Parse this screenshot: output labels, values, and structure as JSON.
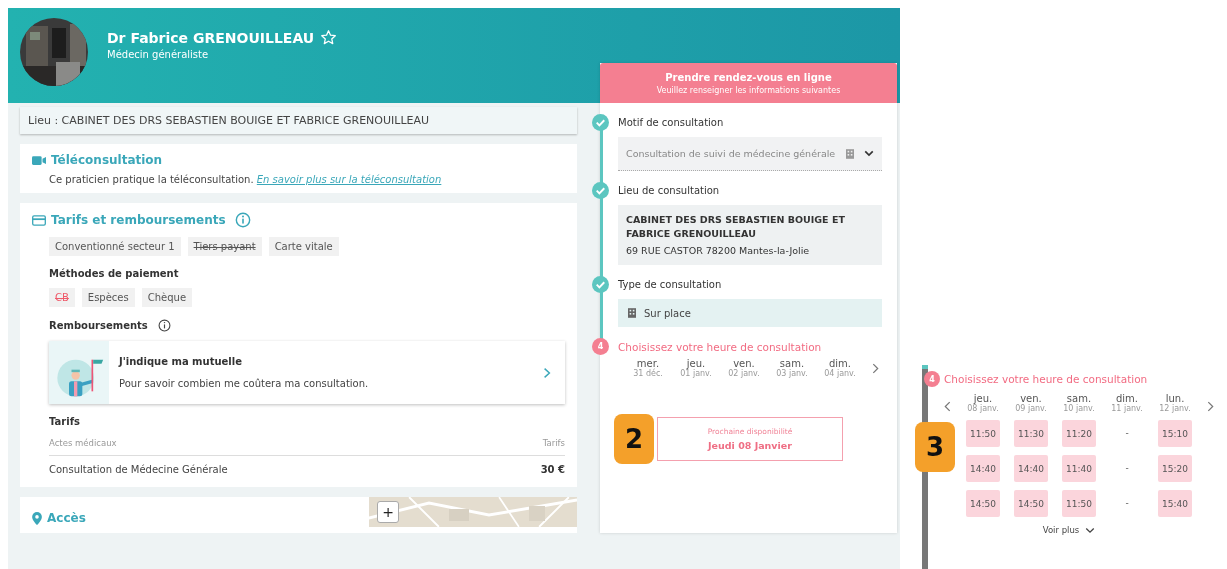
{
  "doctor": {
    "name": "Dr Fabrice GRENOUILLEAU",
    "specialty": "Médecin généraliste",
    "favorite": false
  },
  "location_bar": "Lieu : CABINET DES DRS SEBASTIEN BOUIGE ET FABRICE GRENOUILLEAU",
  "teleconsultation": {
    "title": "Téléconsultation",
    "text": "Ce praticien pratique la téléconsultation.",
    "link": "En savoir plus sur la téléconsultation"
  },
  "tarifs": {
    "title": "Tarifs et remboursements",
    "tags": [
      {
        "label": "Conventionné secteur 1",
        "struck": false
      },
      {
        "label": "Tiers payant",
        "struck": true
      },
      {
        "label": "Carte vitale",
        "struck": false
      }
    ],
    "payment_title": "Méthodes de paiement",
    "payment_methods": [
      {
        "label": "CB",
        "struck": true
      },
      {
        "label": "Espèces",
        "struck": false
      },
      {
        "label": "Chèque",
        "struck": false
      }
    ],
    "reimbursement_title": "Remboursements",
    "mutuelle": {
      "title": "J'indique ma mutuelle",
      "text": "Pour savoir combien me coûtera ma consultation."
    },
    "prices_title": "Tarifs",
    "columns": [
      "Actes médicaux",
      "Tarifs"
    ],
    "rows": [
      {
        "act": "Consultation de Médecine Générale",
        "price": "30 €"
      }
    ]
  },
  "access": {
    "title": "Accès",
    "zoom_in": "+"
  },
  "booking": {
    "title": "Prendre rendez-vous en ligne",
    "subtitle": "Veuillez renseigner les informations suivantes",
    "steps": [
      {
        "kind": "select",
        "done": true,
        "label": "Motif de consultation",
        "value": "Consultation de suivi de médecine générale"
      },
      {
        "kind": "address",
        "done": true,
        "label": "Lieu de consultation",
        "lines": [
          "CABINET DES DRS SEBASTIEN BOUIGE ET FABRICE GRENOUILLEAU",
          "69 RUE CASTOR 78200 Mantes-la-Jolie"
        ]
      },
      {
        "kind": "type",
        "done": true,
        "label": "Type de consultation",
        "value": "Sur place"
      },
      {
        "kind": "days",
        "done": false,
        "number": "4",
        "label": "Choisissez votre heure de consultation",
        "days": [
          {
            "day": "mer.",
            "date": "31 déc."
          },
          {
            "day": "jeu.",
            "date": "01 janv."
          },
          {
            "day": "ven.",
            "date": "02 janv."
          },
          {
            "day": "sam.",
            "date": "03 janv."
          },
          {
            "day": "dim.",
            "date": "04 janv."
          }
        ]
      }
    ],
    "next_availability": {
      "label": "Prochaine disponibilité",
      "date": "Jeudi 08 Janvier"
    }
  },
  "callouts": [
    "2",
    "3"
  ],
  "slot_picker": {
    "number": "4",
    "title": "Choisissez votre heure de consultation",
    "days": [
      {
        "day": "jeu.",
        "date": "08 janv.",
        "available": true,
        "slots": [
          "11:50",
          "14:40",
          "14:50"
        ]
      },
      {
        "day": "ven.",
        "date": "09 janv.",
        "available": true,
        "slots": [
          "11:30",
          "14:40",
          "14:50"
        ]
      },
      {
        "day": "sam.",
        "date": "10 janv.",
        "available": true,
        "slots": [
          "11:20",
          "11:40",
          "11:50"
        ]
      },
      {
        "day": "dim.",
        "date": "11 janv.",
        "available": false,
        "slots": [
          "-",
          "-",
          "-"
        ]
      },
      {
        "day": "lun.",
        "date": "12 janv.",
        "available": true,
        "slots": [
          "15:10",
          "15:20",
          "15:40"
        ]
      }
    ],
    "more": "Voir plus"
  }
}
